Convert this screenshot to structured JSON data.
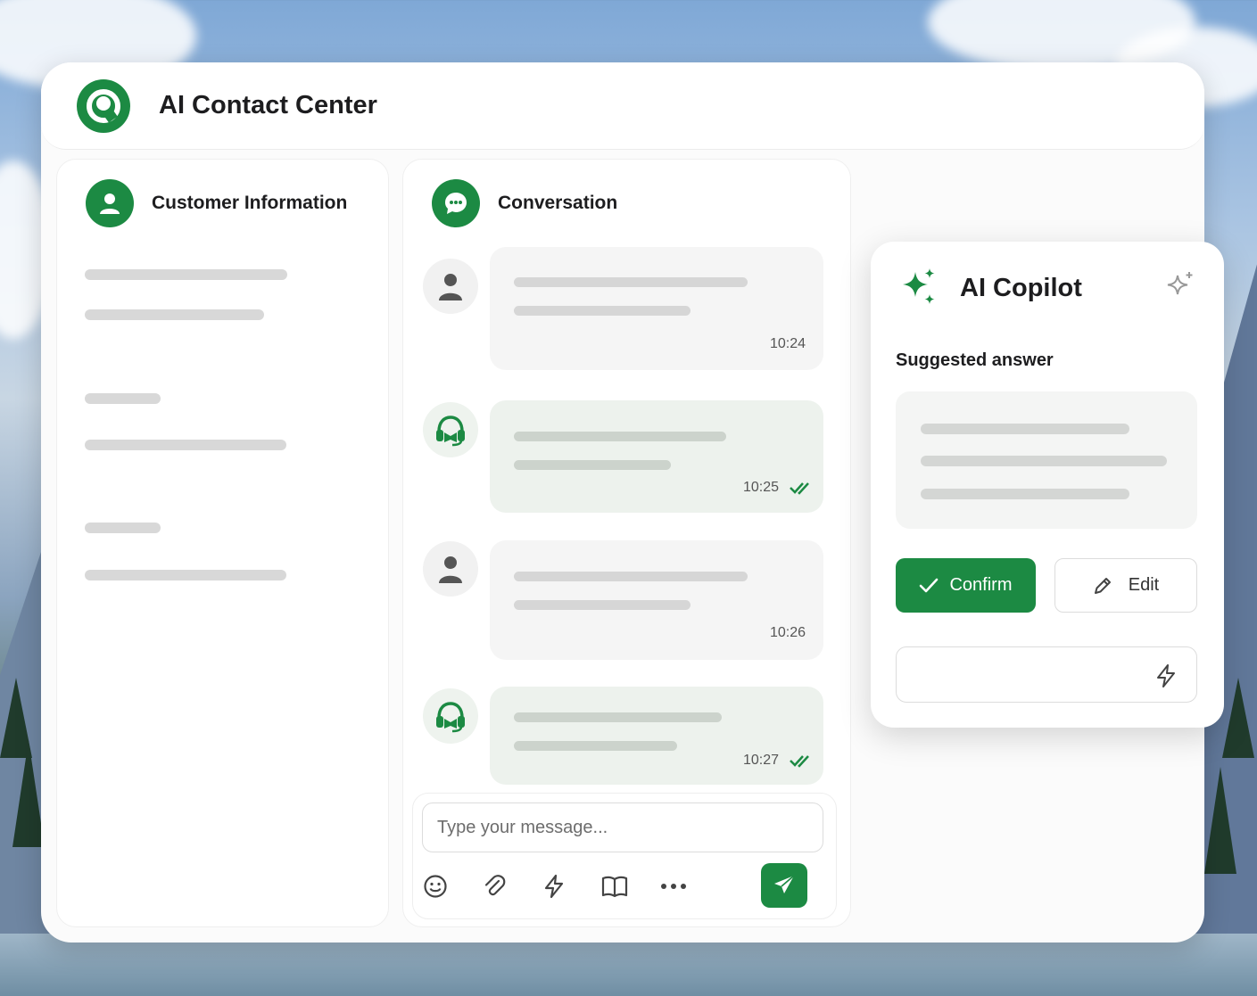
{
  "app": {
    "title": "AI Contact Center",
    "logo_icon": "contact-center-logo-icon"
  },
  "customer_panel": {
    "title": "Customer Information",
    "icon": "user-icon"
  },
  "conversation": {
    "title": "Conversation",
    "icon": "chat-bubble-icon",
    "messages": [
      {
        "sender": "customer",
        "time": "10:24",
        "read": false
      },
      {
        "sender": "agent",
        "time": "10:25",
        "read": true
      },
      {
        "sender": "customer",
        "time": "10:26",
        "read": false
      },
      {
        "sender": "agent",
        "time": "10:27",
        "read": true
      }
    ],
    "composer": {
      "placeholder": "Type your message...",
      "tools": [
        "emoji-icon",
        "paperclip-icon",
        "lightning-icon",
        "book-icon",
        "more-icon"
      ],
      "send_icon": "send-icon"
    }
  },
  "copilot": {
    "title": "AI Copilot",
    "subtitle": "Suggested answer",
    "confirm_label": "Confirm",
    "edit_label": "Edit"
  },
  "colors": {
    "accent": "#1c8a43",
    "skeleton": "#d8d8d8"
  }
}
